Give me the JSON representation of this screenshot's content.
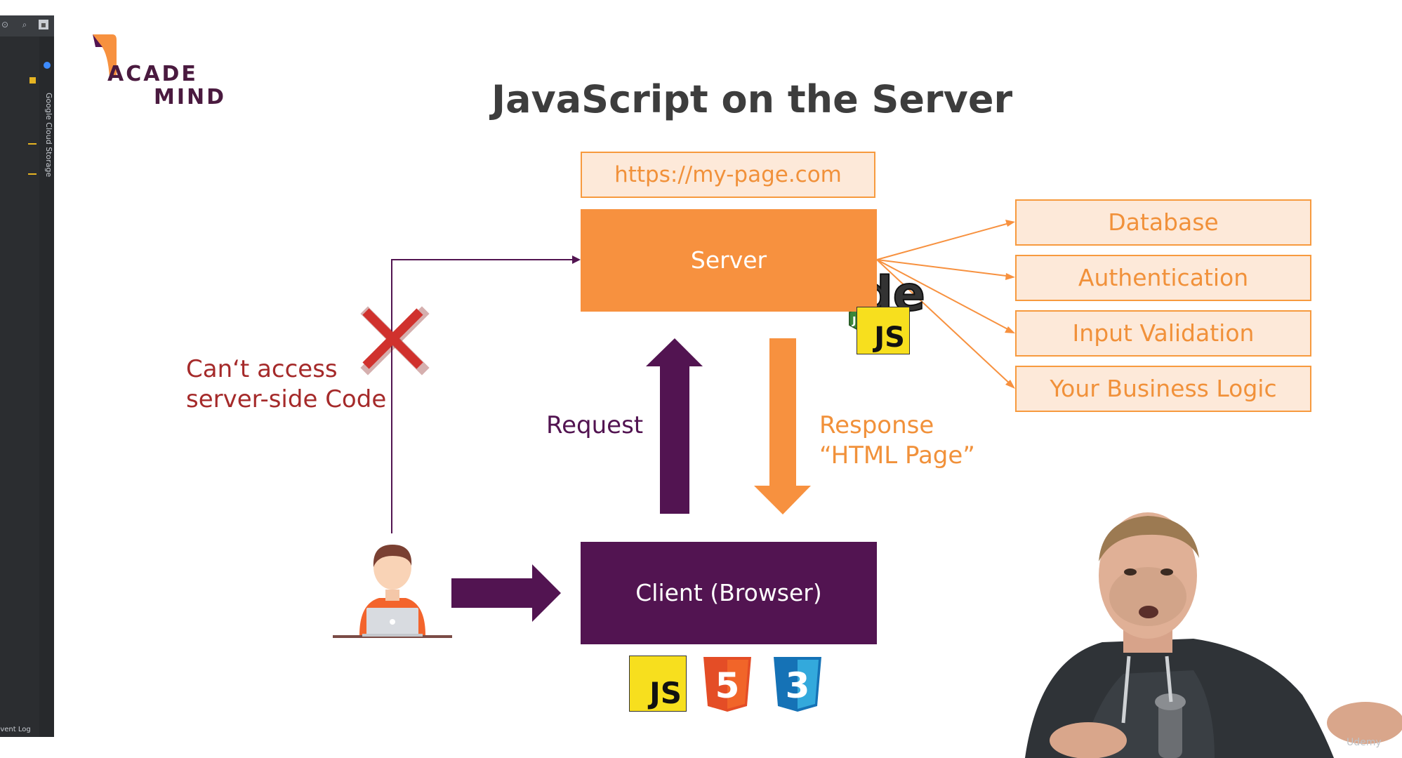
{
  "ide": {
    "vertical_label": "Google Cloud Storage",
    "footer_label": "Event Log"
  },
  "logo": {
    "line1": "ACADE",
    "line2": "MIND"
  },
  "slide": {
    "title": "JavaScript on the Server",
    "url": "https://my-page.com",
    "server": "Server",
    "client": "Client (Browser)",
    "services": [
      "Database",
      "Authentication",
      "Input Validation",
      "Your Business Logic"
    ],
    "request": "Request",
    "response_line1": "Response",
    "response_line2": "“HTML Page”",
    "cant_line1": "Can‘t access",
    "cant_line2": "server-side Code",
    "node_badge": "JS",
    "js_badge": "JS",
    "html5_number": "5",
    "css3_number": "3"
  },
  "colors": {
    "orange": "#f7913f",
    "light_orange": "#fde9d9",
    "purple": "#521451",
    "red": "#d0312d",
    "title": "#3d3d3d"
  },
  "watermark": "Udemy"
}
